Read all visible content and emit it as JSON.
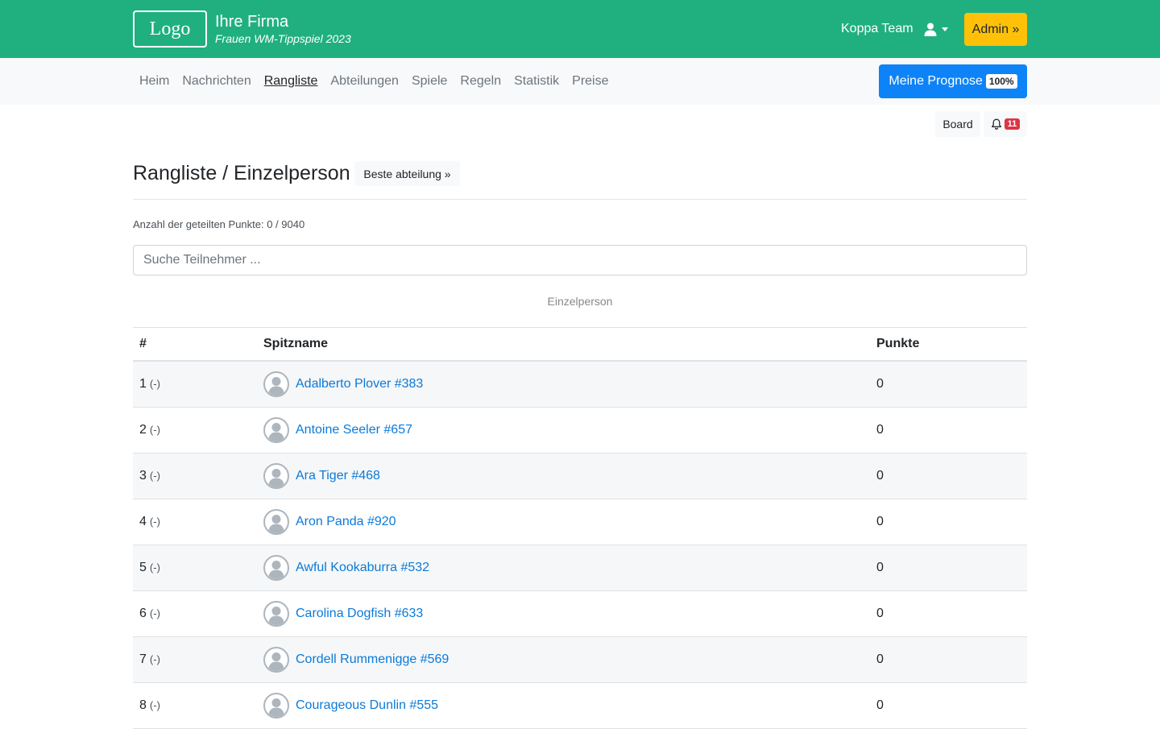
{
  "header": {
    "logo": "Logo",
    "company": "Ihre Firma",
    "subtitle": "Frauen WM-Tippspiel 2023",
    "team": "Koppa Team",
    "admin_label": "Admin »",
    "brand_color": "#20b07f"
  },
  "nav": {
    "items": [
      {
        "label": "Heim"
      },
      {
        "label": "Nachrichten"
      },
      {
        "label": "Rangliste"
      },
      {
        "label": "Abteilungen"
      },
      {
        "label": "Spiele"
      },
      {
        "label": "Regeln"
      },
      {
        "label": "Statistik"
      },
      {
        "label": "Preise"
      }
    ],
    "active": "Rangliste",
    "prognose_label": "Meine Prognose",
    "prognose_pct": "100%"
  },
  "actions": {
    "board_label": "Board",
    "notif_count": "11"
  },
  "page": {
    "title": "Rangliste / Einzelperson",
    "best_label": "Beste abteilung »",
    "shared_points": "Anzahl der geteilten Punkte: 0 / 9040"
  },
  "search": {
    "placeholder": "Suche Teilnehmer ..."
  },
  "table": {
    "caption": "Einzelperson",
    "headers": {
      "rank": "#",
      "name": "Spitzname",
      "points": "Punkte"
    },
    "rows": [
      {
        "rank": "1",
        "delta": "(-)",
        "name": "Adalberto Plover #383",
        "points": "0"
      },
      {
        "rank": "2",
        "delta": "(-)",
        "name": "Antoine Seeler #657",
        "points": "0"
      },
      {
        "rank": "3",
        "delta": "(-)",
        "name": "Ara Tiger #468",
        "points": "0"
      },
      {
        "rank": "4",
        "delta": "(-)",
        "name": "Aron Panda #920",
        "points": "0"
      },
      {
        "rank": "5",
        "delta": "(-)",
        "name": "Awful Kookaburra #532",
        "points": "0"
      },
      {
        "rank": "6",
        "delta": "(-)",
        "name": "Carolina Dogfish #633",
        "points": "0"
      },
      {
        "rank": "7",
        "delta": "(-)",
        "name": "Cordell Rummenigge #569",
        "points": "0"
      },
      {
        "rank": "8",
        "delta": "(-)",
        "name": "Courageous Dunlin #555",
        "points": "0"
      }
    ]
  }
}
